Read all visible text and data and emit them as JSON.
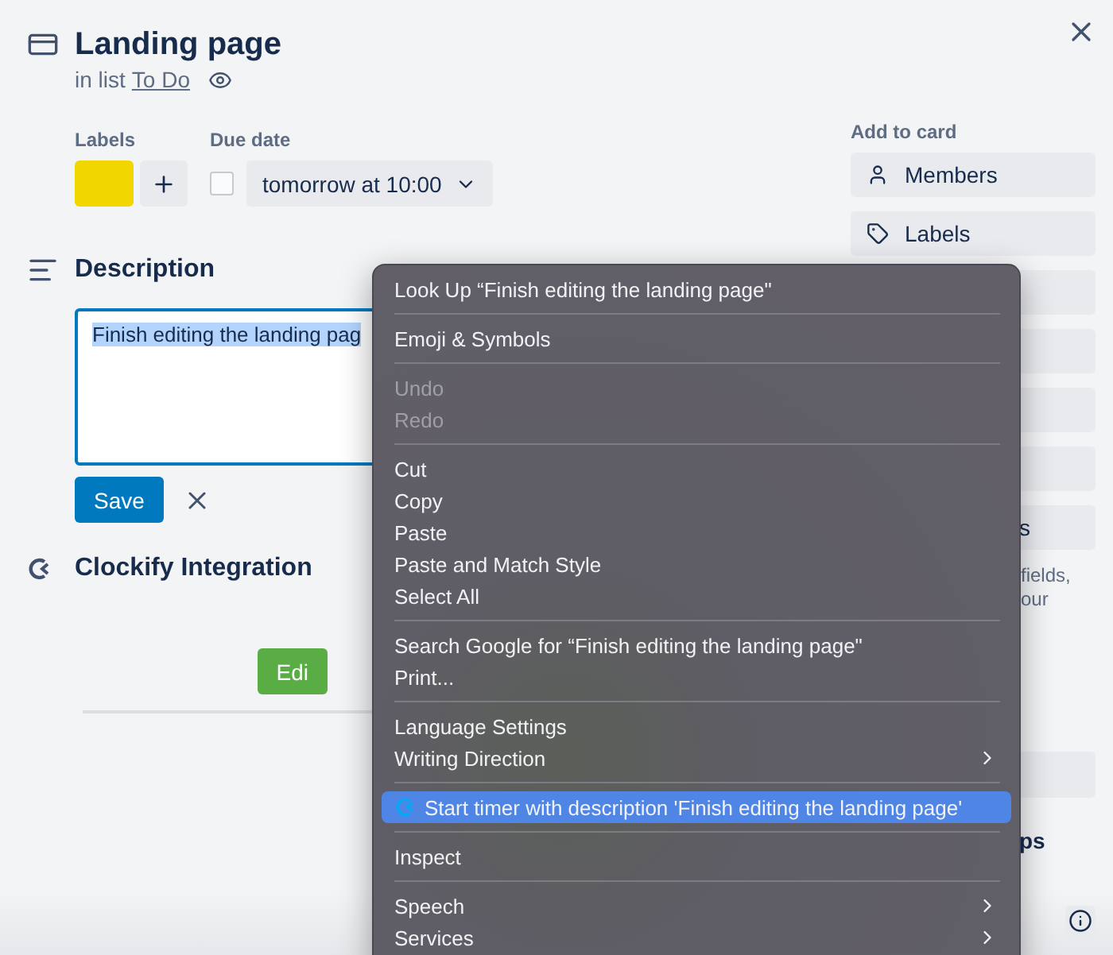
{
  "card": {
    "title": "Landing page",
    "list_prefix": "in list",
    "list_name": "To Do"
  },
  "labels": {
    "heading": "Labels",
    "items": [
      {
        "color": "#f2d600"
      }
    ]
  },
  "due_date": {
    "heading": "Due date",
    "checked": false,
    "value": "tomorrow at 10:00"
  },
  "description": {
    "heading": "Description",
    "value": "Finish editing the landing pag",
    "save": "Save"
  },
  "clockify": {
    "heading": "Clockify Integration",
    "button": "Edi"
  },
  "sidebar": {
    "heading": "Add to card",
    "buttons": [
      {
        "kind": "labeled",
        "label": "Members"
      },
      {
        "kind": "labeled",
        "label": "Labels"
      },
      {
        "kind": "blank"
      },
      {
        "kind": "blank"
      },
      {
        "kind": "blank"
      },
      {
        "kind": "blank"
      },
      {
        "kind": "labeled",
        "label": "s"
      }
    ],
    "note_lines": [
      "fields,",
      "our"
    ],
    "more_buttons": [
      {
        "kind": "blank"
      }
    ],
    "fragment": "ps"
  },
  "context_menu": {
    "items": [
      {
        "kind": "item",
        "label": "Look Up “Finish editing the landing page\"",
        "disabled": false,
        "selected": false,
        "submenu": false
      },
      {
        "kind": "separator"
      },
      {
        "kind": "item",
        "label": "Emoji & Symbols",
        "disabled": false,
        "selected": false,
        "submenu": false
      },
      {
        "kind": "separator"
      },
      {
        "kind": "item",
        "label": "Undo",
        "disabled": true,
        "selected": false,
        "submenu": false
      },
      {
        "kind": "item",
        "label": "Redo",
        "disabled": true,
        "selected": false,
        "submenu": false
      },
      {
        "kind": "separator"
      },
      {
        "kind": "item",
        "label": "Cut",
        "disabled": false,
        "selected": false,
        "submenu": false
      },
      {
        "kind": "item",
        "label": "Copy",
        "disabled": false,
        "selected": false,
        "submenu": false
      },
      {
        "kind": "item",
        "label": "Paste",
        "disabled": false,
        "selected": false,
        "submenu": false
      },
      {
        "kind": "item",
        "label": "Paste and Match Style",
        "disabled": false,
        "selected": false,
        "submenu": false
      },
      {
        "kind": "item",
        "label": "Select All",
        "disabled": false,
        "selected": false,
        "submenu": false
      },
      {
        "kind": "separator"
      },
      {
        "kind": "item",
        "label": "Search Google for “Finish editing the landing page\"",
        "disabled": false,
        "selected": false,
        "submenu": false
      },
      {
        "kind": "item",
        "label": "Print...",
        "disabled": false,
        "selected": false,
        "submenu": false
      },
      {
        "kind": "separator"
      },
      {
        "kind": "item",
        "label": "Language Settings",
        "disabled": false,
        "selected": false,
        "submenu": false
      },
      {
        "kind": "item",
        "label": "Writing Direction",
        "disabled": false,
        "selected": false,
        "submenu": true
      },
      {
        "kind": "separator"
      },
      {
        "kind": "app",
        "label": "Start timer with description 'Finish editing the landing page'",
        "disabled": false,
        "selected": true,
        "submenu": false
      },
      {
        "kind": "separator"
      },
      {
        "kind": "item",
        "label": "Inspect",
        "disabled": false,
        "selected": false,
        "submenu": false
      },
      {
        "kind": "separator"
      },
      {
        "kind": "item",
        "label": "Speech",
        "disabled": false,
        "selected": false,
        "submenu": true
      },
      {
        "kind": "item",
        "label": "Services",
        "disabled": false,
        "selected": false,
        "submenu": true
      }
    ]
  }
}
